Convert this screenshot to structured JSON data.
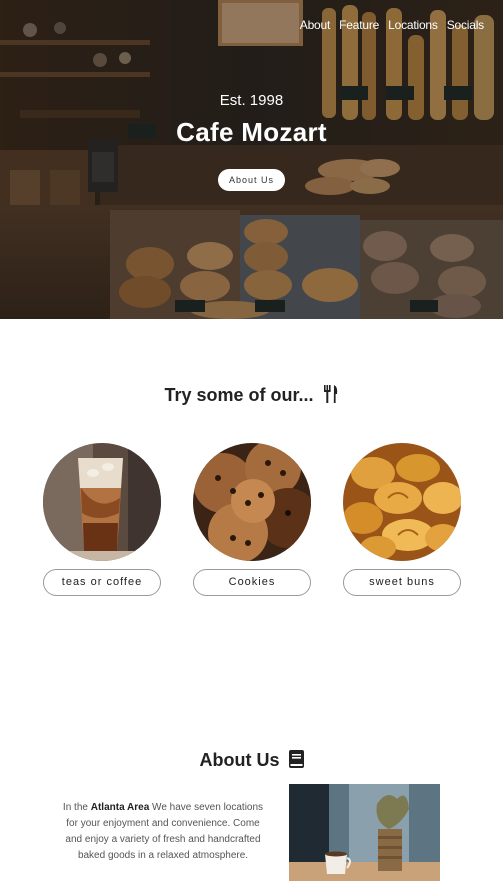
{
  "nav": {
    "items": [
      {
        "label": "About"
      },
      {
        "label": "Feature"
      },
      {
        "label": "Locations"
      },
      {
        "label": "Socials"
      }
    ]
  },
  "hero": {
    "est": "Est. 1998",
    "title": "Cafe Mozart",
    "button_label": "About Us"
  },
  "try_section": {
    "heading": "Try some of our...",
    "heading_icon": "fork-knife-icon",
    "items": [
      {
        "label": "teas or coffee",
        "image": "iced-coffee-image"
      },
      {
        "label": "Cookies",
        "image": "cookies-image"
      },
      {
        "label": "sweet buns",
        "image": "sweet-buns-image"
      }
    ]
  },
  "about_section": {
    "heading": "About Us",
    "heading_icon": "book-icon",
    "text_prefix": "In the ",
    "text_bold": "Atlanta Area",
    "text_suffix": " We have seven locations for your enjoyment and convenience. Come and enjoy a variety of fresh and handcrafted baked goods in a relaxed atmosphere.",
    "image": "coffee-cup-and-plant-image"
  }
}
